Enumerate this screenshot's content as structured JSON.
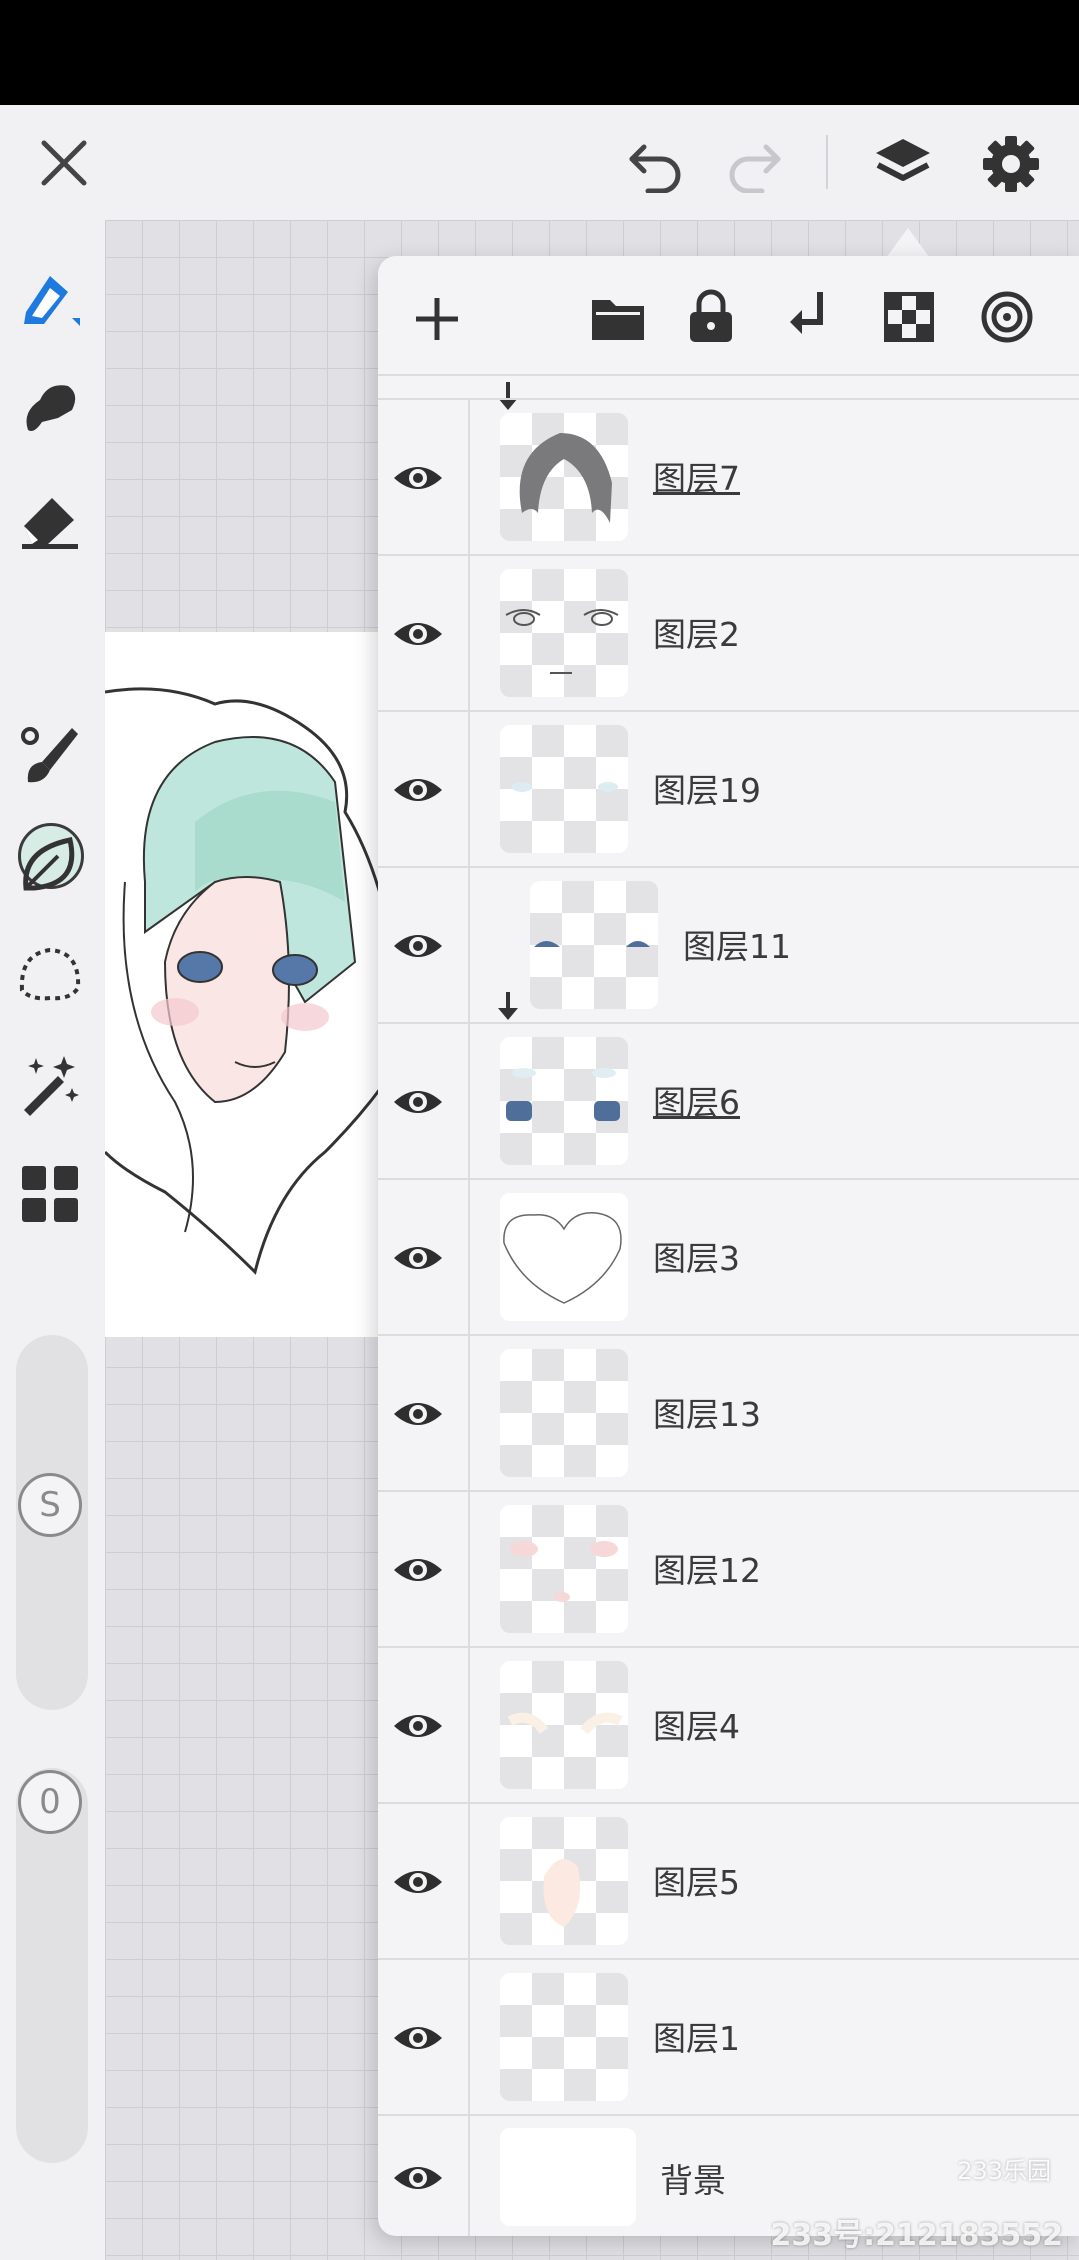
{
  "topbar": {
    "icons": [
      "close-icon",
      "undo-icon",
      "redo-icon",
      "layers-icon",
      "gear-icon"
    ]
  },
  "toolbar": {
    "tools": [
      "pen-icon",
      "smudge-icon",
      "eraser-icon",
      "brush-icon",
      "blur-leaf-icon",
      "lasso-icon",
      "magic-wand-icon",
      "grid-menu-icon"
    ],
    "current_color": "#d6ece5",
    "size_slider_label": "S",
    "opacity_slider_label": "0"
  },
  "layer_panel": {
    "toolbar_icons": [
      "add-icon",
      "folder-icon",
      "lock-icon",
      "clip-icon",
      "alpha-lock-icon",
      "blend-mode-icon"
    ],
    "layers": [
      {
        "name": "图层7",
        "active": true
      },
      {
        "name": "图层2",
        "active": false
      },
      {
        "name": "图层19",
        "active": false
      },
      {
        "name": "图层11",
        "active": false
      },
      {
        "name": "图层6",
        "active": true
      },
      {
        "name": "图层3",
        "active": false
      },
      {
        "name": "图层13",
        "active": false
      },
      {
        "name": "图层12",
        "active": false
      },
      {
        "name": "图层4",
        "active": false
      },
      {
        "name": "图层5",
        "active": false
      },
      {
        "name": "图层1",
        "active": false
      },
      {
        "name": "背景",
        "active": false
      }
    ]
  },
  "watermark": {
    "logo": "233乐园",
    "id_text": "233号:212183552"
  }
}
